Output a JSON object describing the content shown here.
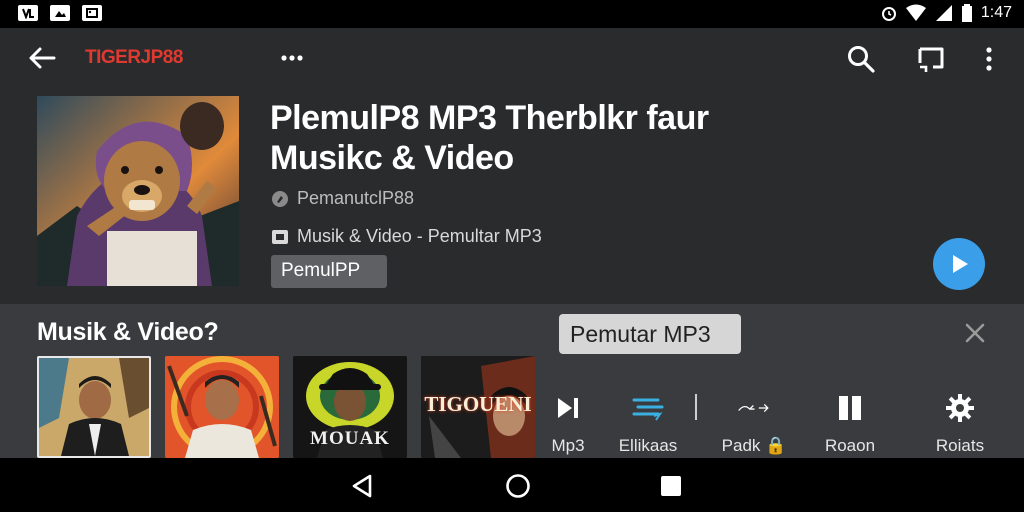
{
  "status_bar": {
    "time": "1:47",
    "left_icons": [
      "vlc-icon",
      "image-icon",
      "gallery-icon"
    ],
    "right_icons": [
      "alarm-icon",
      "wifi-icon",
      "signal-icon",
      "battery-icon"
    ]
  },
  "top_bar": {
    "app_title": "TIGERJP88"
  },
  "header": {
    "title_line1": "PlemulP8 MP3 Therblkr faur",
    "title_line2": "Musikc & Video",
    "artist": "PemanutclP88",
    "album": "Musik & Video - Pemultar MP3",
    "tag": "PemulPP"
  },
  "panel": {
    "title": "Musik & Video?",
    "chip": "Pemutar MP3",
    "thumbnails": [
      {
        "caption": ""
      },
      {
        "caption": ""
      },
      {
        "caption": "MOUAK"
      },
      {
        "caption": "TIGOUENI"
      }
    ],
    "actions": [
      {
        "label": "Mp3",
        "icon": "skip-play-icon"
      },
      {
        "label": "Ellikaas",
        "icon": "queue-icon"
      },
      {
        "label": "Padk",
        "icon": "shuffle-icon"
      },
      {
        "label": "Roaon",
        "icon": "pause-icon"
      },
      {
        "label": "Roiats",
        "icon": "settings-icon"
      }
    ]
  },
  "colors": {
    "accent_red": "#e0392f",
    "fab_blue": "#3b9ee8",
    "header_bg": "#2a2b2d",
    "panel_bg": "#3a3b3e"
  }
}
